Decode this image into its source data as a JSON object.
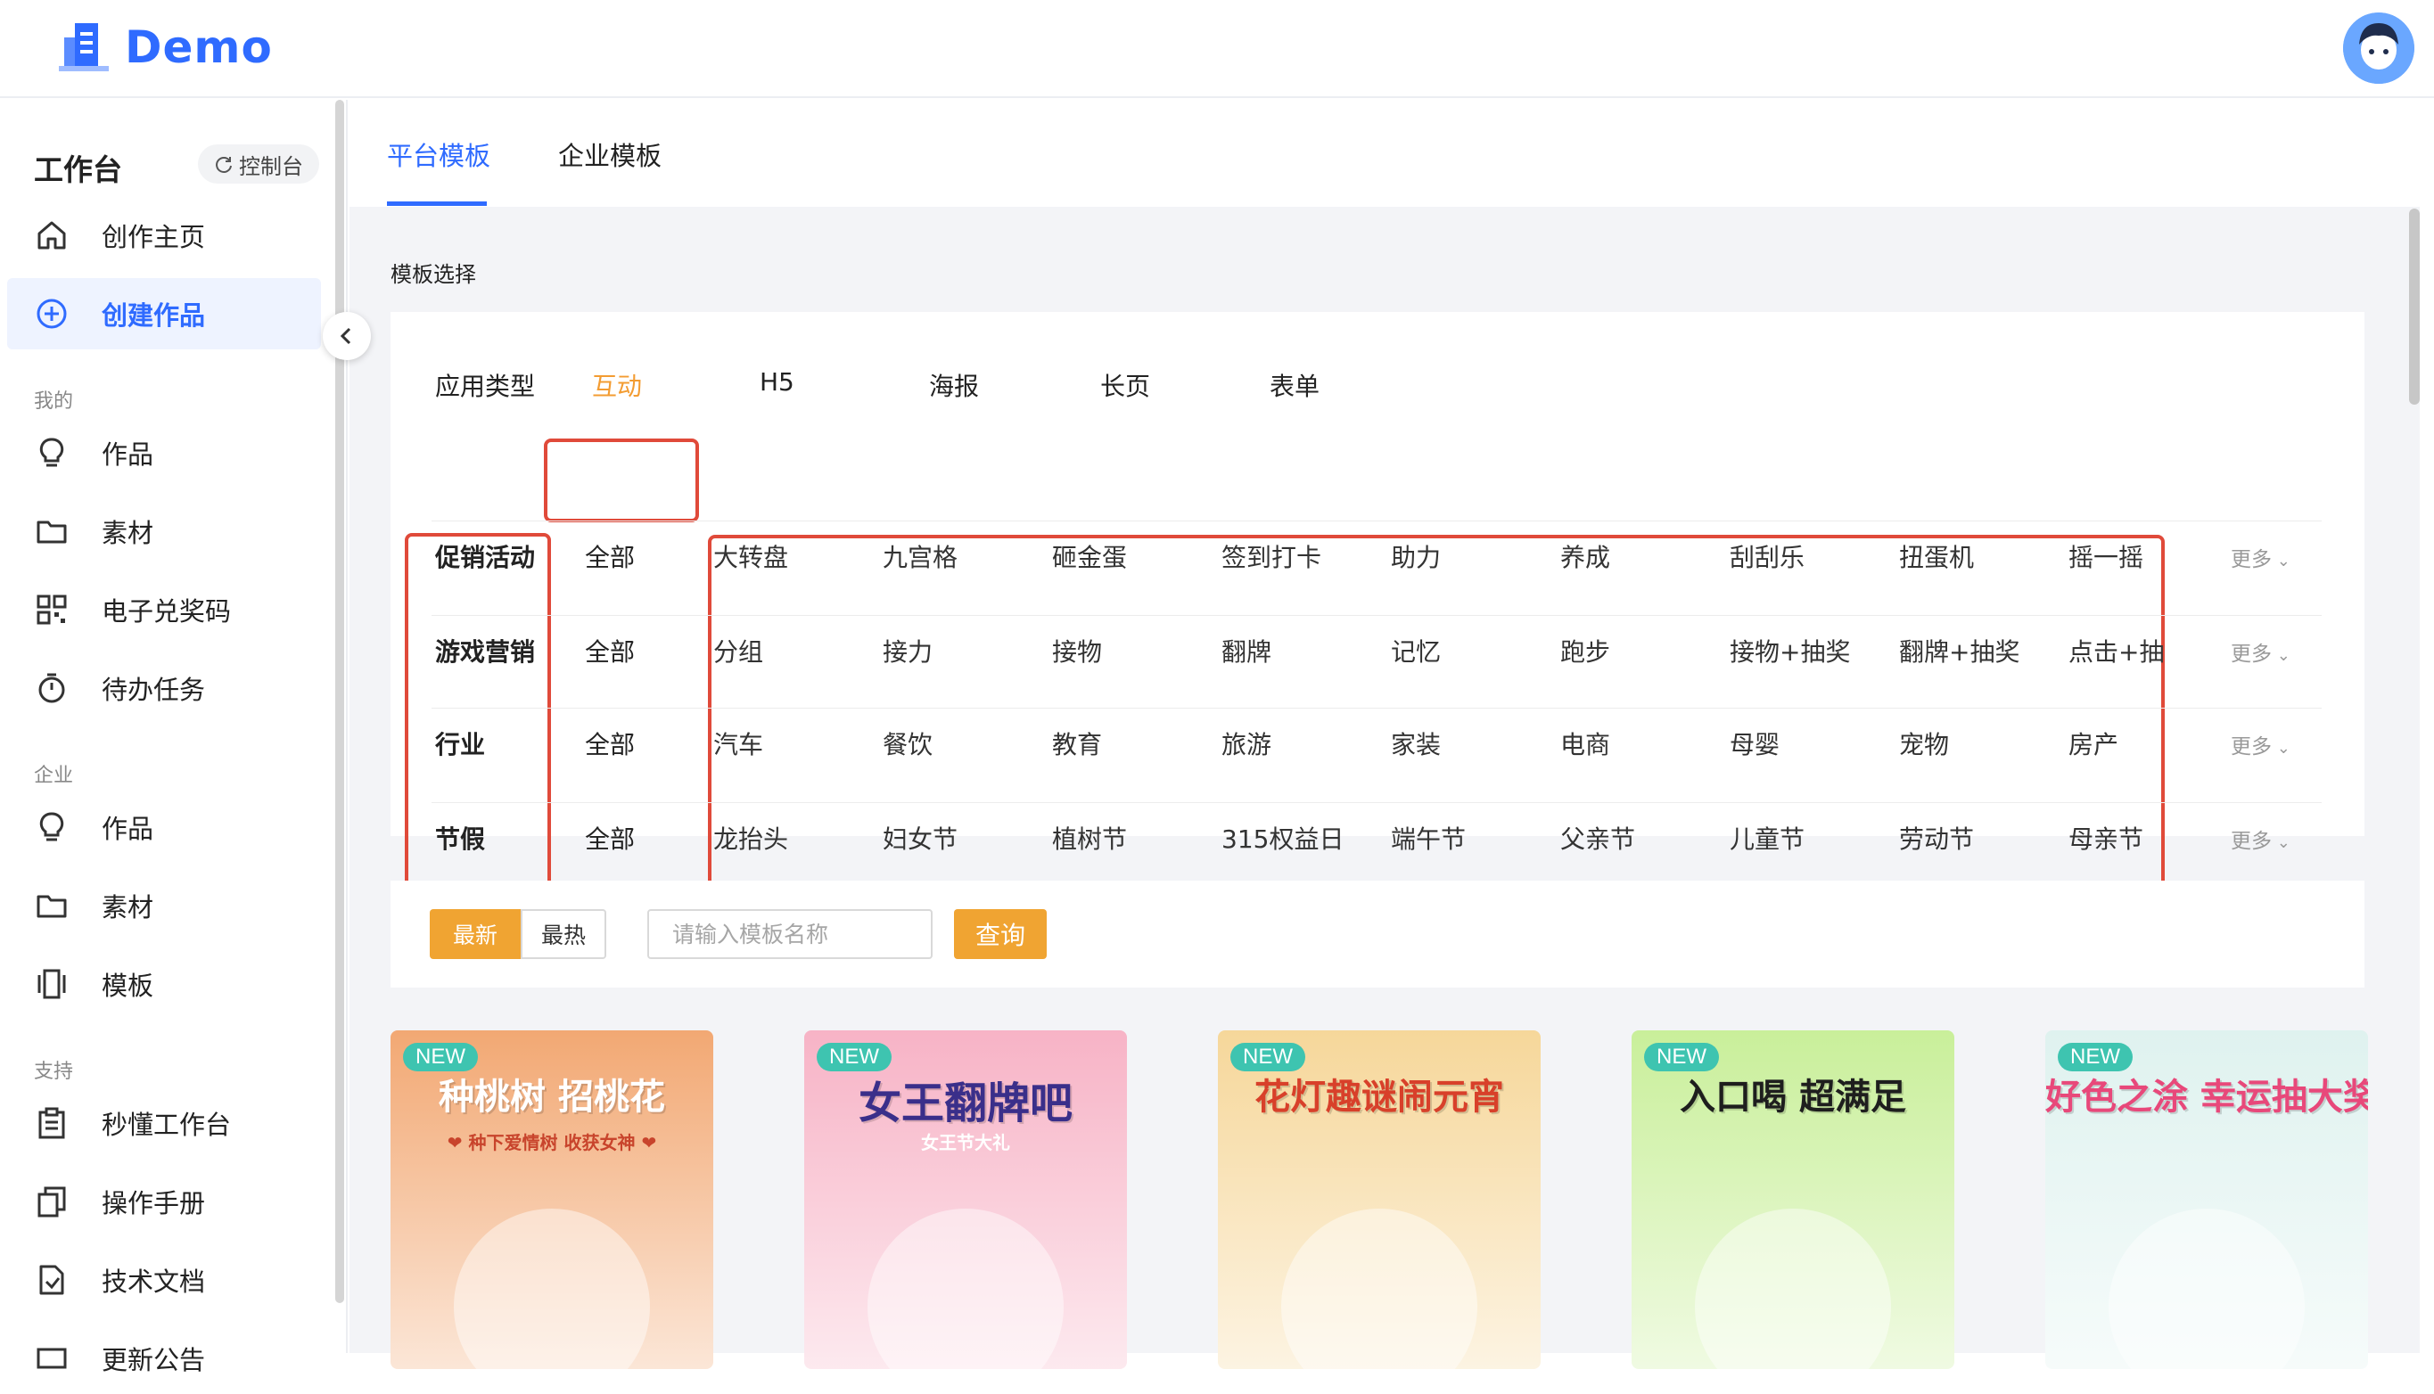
{
  "app": {
    "logo_text": "Demo"
  },
  "sidebar": {
    "workspace_title": "工作台",
    "console_button": "控制台",
    "items_top": [
      {
        "label": "创作主页",
        "icon": "home-icon"
      },
      {
        "label": "创建作品",
        "icon": "plus-circle-icon",
        "active": true
      }
    ],
    "section_mine": "我的",
    "items_mine": [
      {
        "label": "作品",
        "icon": "bulb-icon"
      },
      {
        "label": "素材",
        "icon": "folder-icon"
      },
      {
        "label": "电子兑奖码",
        "icon": "qrcode-icon"
      },
      {
        "label": "待办任务",
        "icon": "timer-icon"
      }
    ],
    "section_company": "企业",
    "items_company": [
      {
        "label": "作品",
        "icon": "bulb-icon"
      },
      {
        "label": "素材",
        "icon": "folder-icon"
      },
      {
        "label": "模板",
        "icon": "template-icon"
      }
    ],
    "section_support": "支持",
    "items_support": [
      {
        "label": "秒懂工作台",
        "icon": "clipboard-icon"
      },
      {
        "label": "操作手册",
        "icon": "copy-icon"
      },
      {
        "label": "技术文档",
        "icon": "doc-icon"
      },
      {
        "label": "更新公告",
        "icon": "announce-icon"
      }
    ]
  },
  "tabs": [
    {
      "label": "平台模板",
      "active": true
    },
    {
      "label": "企业模板"
    }
  ],
  "template_section_title": "模板选择",
  "app_type": {
    "label": "应用类型",
    "items": [
      "互动",
      "H5",
      "海报",
      "长页",
      "表单"
    ],
    "active_index": 0
  },
  "categories": [
    {
      "name": "促销活动",
      "all": "全部",
      "options": [
        "大转盘",
        "九宫格",
        "砸金蛋",
        "签到打卡",
        "助力",
        "养成",
        "刮刮乐",
        "扭蛋机",
        "摇一摇"
      ],
      "more": "更多"
    },
    {
      "name": "游戏营销",
      "all": "全部",
      "options": [
        "分组",
        "接力",
        "接物",
        "翻牌",
        "记忆",
        "跑步",
        "接物+抽奖",
        "翻牌+抽奖",
        "点击+抽奖"
      ],
      "more": "更多"
    },
    {
      "name": "行业",
      "all": "全部",
      "options": [
        "汽车",
        "餐饮",
        "教育",
        "旅游",
        "家装",
        "电商",
        "母婴",
        "宠物",
        "房产"
      ],
      "more": "更多"
    },
    {
      "name": "节假",
      "all": "全部",
      "options": [
        "龙抬头",
        "妇女节",
        "植树节",
        "315权益日",
        "端午节",
        "父亲节",
        "儿童节",
        "劳动节",
        "母亲节"
      ],
      "more": "更多"
    }
  ],
  "filter": {
    "sort_latest": "最新",
    "sort_hot": "最热",
    "search_placeholder": "请输入模板名称",
    "query_button": "查询"
  },
  "cards": [
    {
      "badge": "NEW",
      "title": "种桃树 招桃花",
      "subtitle": "❤ 种下爱情树 收获女神 ❤",
      "bg": "#f2a873"
    },
    {
      "badge": "NEW",
      "title": "女王翻牌吧",
      "subtitle": "女王节大礼",
      "bg": "#f7b3c6"
    },
    {
      "badge": "NEW",
      "title": "花灯趣谜闹元宵",
      "subtitle": "",
      "bg": "#f6d79a"
    },
    {
      "badge": "NEW",
      "title": "入口喝 超满足",
      "subtitle": "",
      "bg": "#c9ef9a"
    },
    {
      "badge": "NEW",
      "title": "好色之涂 幸运抽大奖",
      "subtitle": "",
      "bg": "#dff2ef"
    }
  ],
  "colors": {
    "accent_blue": "#2f6bff",
    "accent_orange": "#f0a432",
    "highlight_red": "#e04a3a"
  }
}
